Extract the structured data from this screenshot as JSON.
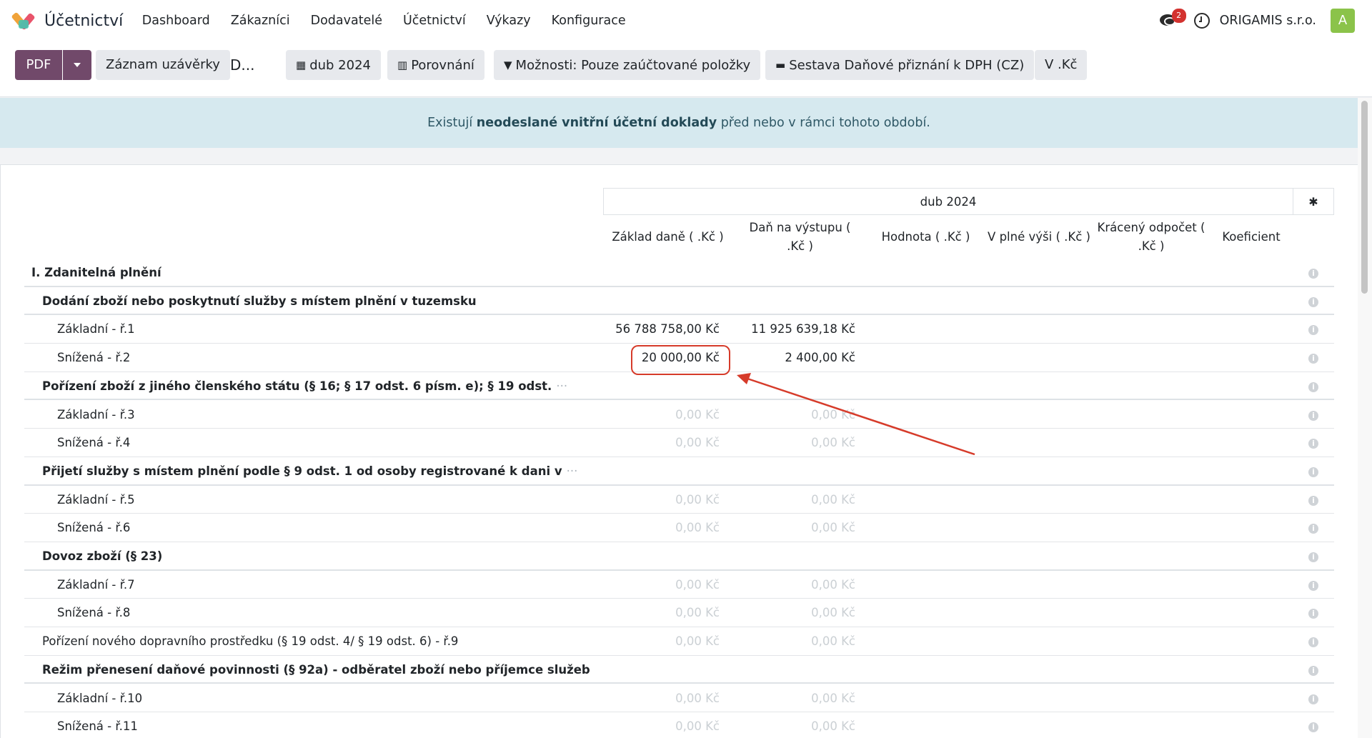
{
  "app": {
    "name": "Účetnictví",
    "menu": [
      "Dashboard",
      "Zákazníci",
      "Dodavatelé",
      "Účetnictví",
      "Výkazy",
      "Konfigurace"
    ],
    "notification_count": "2",
    "company": "ORIGAMIS s.r.o.",
    "avatar_letter": "A"
  },
  "toolbar": {
    "pdf": "PDF",
    "closing_entry": "Záznam uzávěrky",
    "breadcrumb": "D...",
    "period": "dub 2024",
    "comparison": "Porovnání",
    "options": "Možnosti: Pouze zaúčtované položky",
    "report": "Sestava Daňové přiznání k DPH (CZ)",
    "currency": "V .Kč"
  },
  "alert": {
    "before": "Existují ",
    "bold": "neodeslané vnitřní účetní doklady",
    "after": " před nebo v rámci tohoto období."
  },
  "report": {
    "period_header": "dub 2024",
    "columns": [
      "Základ daně ( .Kč )",
      "Daň na výstupu ( .Kč )",
      "Hodnota ( .Kč )",
      "V plné výši ( .Kč )",
      "Krácený odpočet ( .Kč )",
      "Koeficient"
    ],
    "rows": [
      {
        "label": "I. Zdanitelná plnění",
        "bold": true,
        "level": 0,
        "values": []
      },
      {
        "label": "Dodání zboží nebo poskytnutí služby s místem plnění v tuzemsku",
        "bold": true,
        "level": 1,
        "values": []
      },
      {
        "label": "Základní - ř.1",
        "bold": false,
        "level": 2,
        "values": [
          "56 788 758,00 Kč",
          "11 925 639,18 Kč"
        ],
        "muted": false
      },
      {
        "label": "Snížená - ř.2",
        "bold": false,
        "level": 2,
        "values": [
          "20 000,00 Kč",
          "2 400,00 Kč"
        ],
        "muted": false
      },
      {
        "label": "Pořízení zboží z jiného členského státu (§ 16; § 17 odst. 6 písm. e); § 19 odst.",
        "bold": true,
        "level": 1,
        "values": [],
        "ellipsis": "···"
      },
      {
        "label": "Základní - ř.3",
        "bold": false,
        "level": 2,
        "values": [
          "0,00 Kč",
          "0,00 Kč"
        ],
        "muted": true
      },
      {
        "label": "Snížená - ř.4",
        "bold": false,
        "level": 2,
        "values": [
          "0,00 Kč",
          "0,00 Kč"
        ],
        "muted": true
      },
      {
        "label": "Přijetí služby s místem plnění podle § 9 odst. 1 od osoby registrované k dani v",
        "bold": true,
        "level": 1,
        "values": [],
        "ellipsis": "···"
      },
      {
        "label": "Základní - ř.5",
        "bold": false,
        "level": 2,
        "values": [
          "0,00 Kč",
          "0,00 Kč"
        ],
        "muted": true
      },
      {
        "label": "Snížená - ř.6",
        "bold": false,
        "level": 2,
        "values": [
          "0,00 Kč",
          "0,00 Kč"
        ],
        "muted": true
      },
      {
        "label": "Dovoz zboží (§ 23)",
        "bold": true,
        "level": 1,
        "values": []
      },
      {
        "label": "Základní - ř.7",
        "bold": false,
        "level": 2,
        "values": [
          "0,00 Kč",
          "0,00 Kč"
        ],
        "muted": true
      },
      {
        "label": "Snížená - ř.8",
        "bold": false,
        "level": 2,
        "values": [
          "0,00 Kč",
          "0,00 Kč"
        ],
        "muted": true
      },
      {
        "label": "Pořízení nového dopravního prostředku (§ 19 odst. 4/ § 19 odst. 6) - ř.9",
        "bold": false,
        "level": 1,
        "values": [
          "0,00 Kč",
          "0,00 Kč"
        ],
        "muted": true
      },
      {
        "label": "Režim přenesení daňové povinnosti (§ 92a) - odběratel zboží nebo příjemce služeb",
        "bold": true,
        "level": 1,
        "values": []
      },
      {
        "label": "Základní - ř.10",
        "bold": false,
        "level": 2,
        "values": [
          "0,00 Kč",
          "0,00 Kč"
        ],
        "muted": true
      },
      {
        "label": "Snížená - ř.11",
        "bold": false,
        "level": 2,
        "values": [
          "0,00 Kč",
          "0,00 Kč"
        ],
        "muted": true
      }
    ]
  },
  "colors": {
    "primary": "#71496a",
    "alert_bg": "#d6e9ef",
    "annotation": "#d63b2a"
  }
}
